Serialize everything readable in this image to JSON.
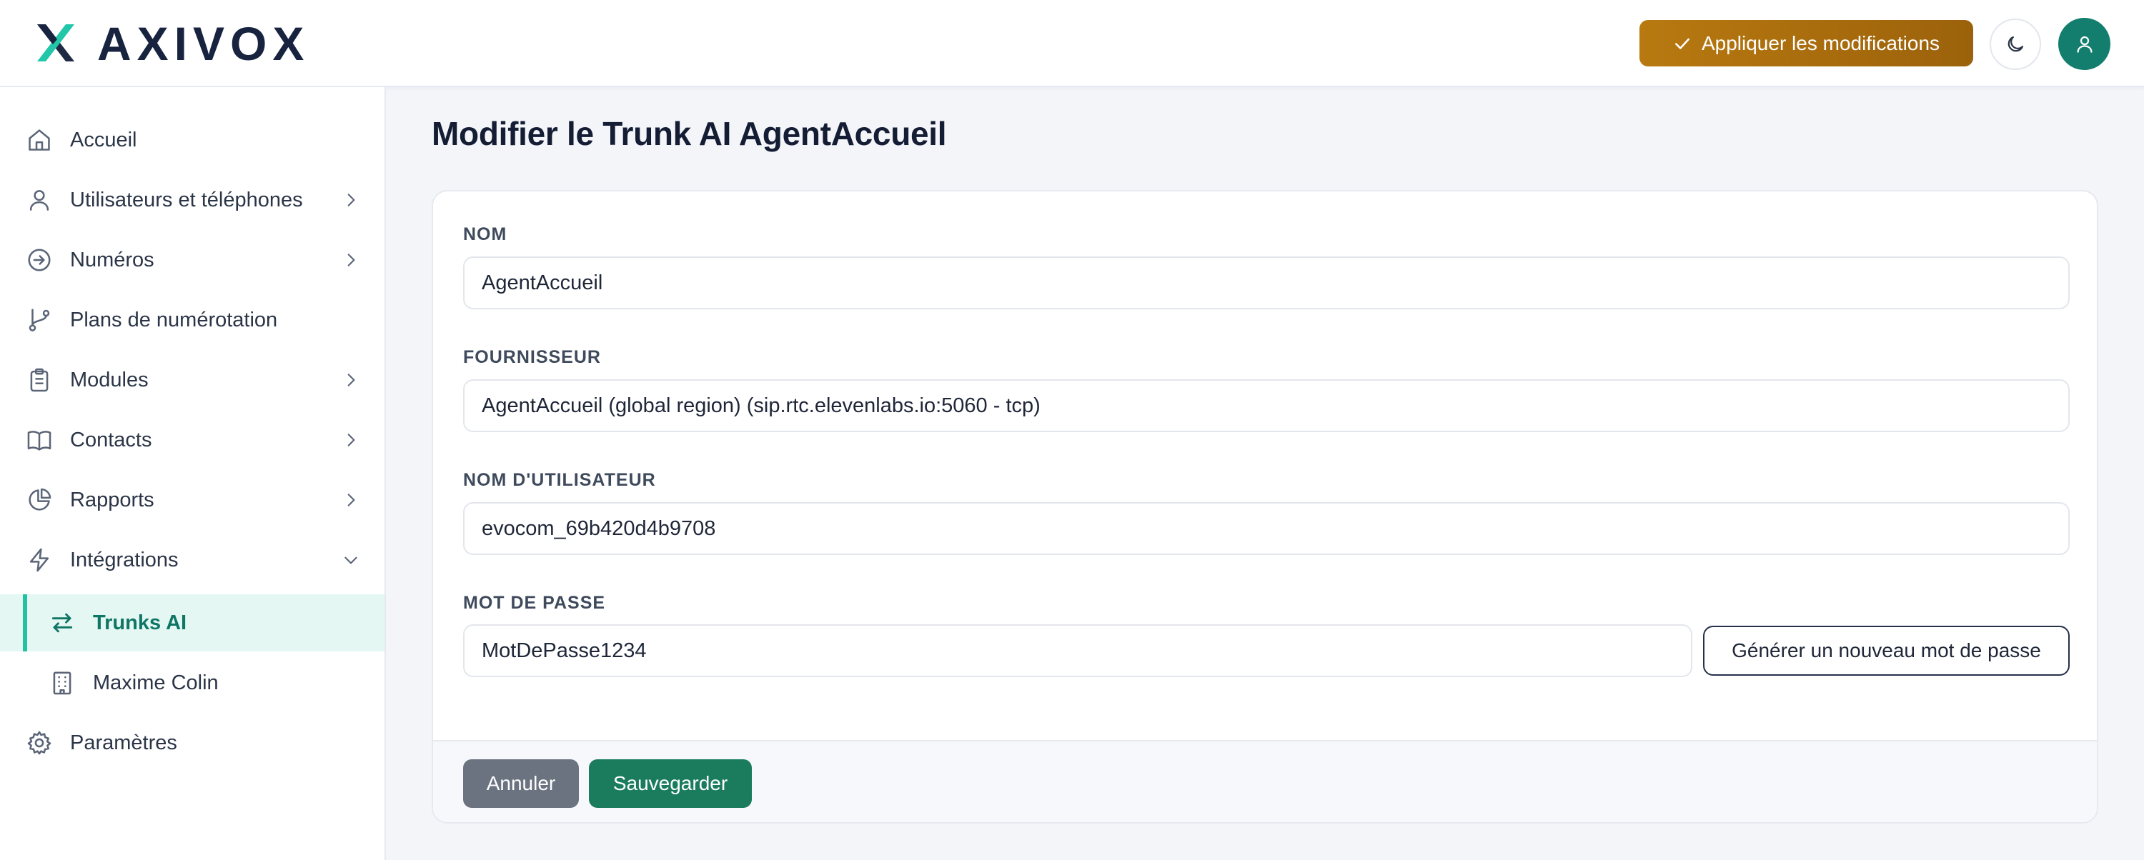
{
  "brand": {
    "name": "AXIVOX"
  },
  "header": {
    "apply_label": "Appliquer les modifications",
    "theme_icon": "moon-icon",
    "avatar_icon": "user-icon"
  },
  "sidebar": {
    "items": [
      {
        "label": "Accueil",
        "icon": "home-icon"
      },
      {
        "label": "Utilisateurs et téléphones",
        "icon": "user-icon",
        "expandable": true
      },
      {
        "label": "Numéros",
        "icon": "arrow-circle-icon",
        "expandable": true
      },
      {
        "label": "Plans de numérotation",
        "icon": "git-branch-icon"
      },
      {
        "label": "Modules",
        "icon": "clipboard-icon",
        "expandable": true
      },
      {
        "label": "Contacts",
        "icon": "book-icon",
        "expandable": true
      },
      {
        "label": "Rapports",
        "icon": "pie-chart-icon",
        "expandable": true
      },
      {
        "label": "Intégrations",
        "icon": "bolt-icon",
        "expanded": true
      },
      {
        "label": "Trunks AI",
        "icon": "swap-arrows-icon",
        "active": true,
        "sub": true
      },
      {
        "label": "Maxime Colin",
        "icon": "building-icon",
        "sub": true
      },
      {
        "label": "Paramètres",
        "icon": "gear-icon"
      }
    ]
  },
  "main": {
    "title": "Modifier le Trunk AI AgentAccueil",
    "form": {
      "name_label": "NOM",
      "name_value": "AgentAccueil",
      "provider_label": "FOURNISSEUR",
      "provider_value": "AgentAccueil (global region) (sip.rtc.elevenlabs.io:5060 - tcp)",
      "username_label": "NOM D'UTILISATEUR",
      "username_value": "evocom_69b420d4b9708",
      "password_label": "MOT DE PASSE",
      "password_value": "MotDePasse1234",
      "generate_label": "Générer un nouveau mot de passe"
    },
    "footer": {
      "cancel_label": "Annuler",
      "save_label": "Sauvegarder"
    }
  },
  "colors": {
    "accent_teal": "#137e6e",
    "apply_gold": "#a86d0d",
    "save_green": "#1a7c5d",
    "cancel_gray": "#6b7380",
    "active_bg": "#e4f7f3"
  }
}
